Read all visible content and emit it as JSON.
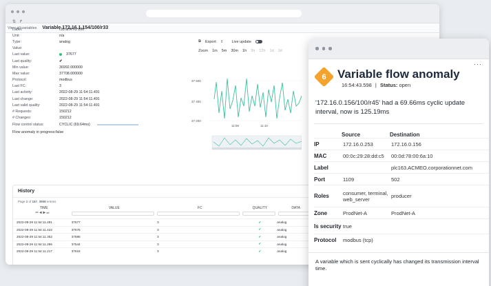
{
  "back": {
    "crumb_link": "View all variables",
    "crumb_title": "Variable 172.16.1.154/100/r33",
    "props": [
      {
        "k": "Label:",
        "v": "r33 at RTU 100"
      },
      {
        "k": "Unit:",
        "v": "n/a"
      },
      {
        "k": "Type:",
        "v": "analog"
      },
      {
        "k": "Value:",
        "v": ""
      },
      {
        "k": "Last value:",
        "v": "37677"
      },
      {
        "k": "Last quality:",
        "v": "✔"
      },
      {
        "k": "Min value:",
        "v": "36992.000000"
      },
      {
        "k": "Max value:",
        "v": "37708.000000"
      },
      {
        "k": "Protocol:",
        "v": "modbus"
      },
      {
        "k": "Last FC:",
        "v": "3"
      },
      {
        "k": "Last activity:",
        "v": "2022-08-29 11:54:11.491"
      },
      {
        "k": "Last change:",
        "v": "2022-08-29 11:54:11.491"
      },
      {
        "k": "Last valid quality:",
        "v": "2022-08-29 11:54:11.491"
      },
      {
        "k": "# Requests:",
        "v": "150212"
      },
      {
        "k": "# Changes:",
        "v": "150212"
      }
    ],
    "flow_control_label": "Flow control status:",
    "flow_control_value": "CYCLIC (69.64ms)",
    "flow_anomaly_label": "Flow anomaly in progress:",
    "flow_anomaly_value": "false",
    "export_label": "Export",
    "live_update_label": "Live update",
    "zoom_label": "Zoom",
    "zoom_active": [
      "1m",
      "5m",
      "30m",
      "1h"
    ],
    "zoom_dim": [
      "3h",
      "12h",
      "1d",
      "3d"
    ],
    "y_ticks": [
      "37 600",
      "37 400",
      "37 200"
    ],
    "x_ticks": [
      "11:08",
      "11:10"
    ],
    "history": {
      "title": "History",
      "meta_prefix": "Page ",
      "meta_page": "1",
      "meta_of": " of ",
      "meta_pages": "157",
      "meta_sep": ", ",
      "meta_count": "3908",
      "meta_suffix": " entries",
      "pager": "⏮ ◀ ▶ ⏭",
      "columns": [
        "TIME",
        "VALUE",
        "FC",
        "QUALITY",
        "DATA"
      ],
      "rows": [
        {
          "time": "2022-08-29 11:54:11.491",
          "value": "37677",
          "fc": "3",
          "quality": "✔",
          "dt": "analog"
        },
        {
          "time": "2022-08-29 11:54:11.422",
          "value": "37676",
          "fc": "3",
          "quality": "✔",
          "dt": "analog"
        },
        {
          "time": "2022-08-29 11:54:11.352",
          "value": "37595",
          "fc": "3",
          "quality": "✔",
          "dt": "analog"
        },
        {
          "time": "2022-08-29 11:54:11.286",
          "value": "37544",
          "fc": "3",
          "quality": "✔",
          "dt": "analog"
        },
        {
          "time": "2022-08-29 11:54:11.217",
          "value": "37616",
          "fc": "3",
          "quality": "✔",
          "dt": "analog"
        }
      ]
    }
  },
  "card": {
    "badge": "6",
    "title": "Variable flow anomaly",
    "time": "16:54:43.598",
    "status_label": "Status:",
    "status_value": "open",
    "description": "'172.16.0.156/100/r45' had a 69.66ms cyclic update interval, now is 125.19ms",
    "col_source": "Source",
    "col_destination": "Destination",
    "rows": [
      {
        "label": "IP",
        "src": "172.16.0.253",
        "dst": "172.16.0.156"
      },
      {
        "label": "MAC",
        "src": "00:0c:29:28:dd:c5",
        "dst": "00:0d:78:00:6a:10"
      },
      {
        "label": "Label",
        "src": "",
        "dst": "plc163.ACMEO.corporationnet.com"
      },
      {
        "label": "Port",
        "src": "1109",
        "dst": "502"
      },
      {
        "label": "Roles",
        "src": "consumer, terminal, web_server",
        "dst": "producer"
      },
      {
        "label": "Zone",
        "src": "ProdNet-A",
        "dst": "ProdNet-A"
      },
      {
        "label": "Is security",
        "src": "true",
        "dst": ""
      },
      {
        "label": "Protocol",
        "src": "modbus (tcp)",
        "dst": ""
      }
    ],
    "footer": "A variable which is sent cyclically has changed its transmission interval time."
  },
  "colors": {
    "accent": "#f4a42c",
    "line": "#3bbf9f",
    "ok": "#3bbf8f"
  }
}
